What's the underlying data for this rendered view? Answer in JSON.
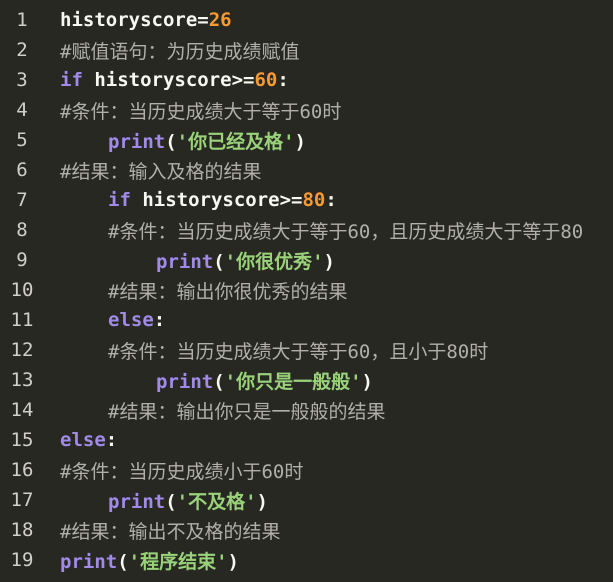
{
  "editor": {
    "lines": [
      {
        "num": "1",
        "parts": {
          "a": "historyscore=",
          "b": "26"
        }
      },
      {
        "num": "2",
        "comment": "#赋值语句：为历史成绩赋值"
      },
      {
        "num": "3",
        "parts": {
          "kw": "if",
          "a": " historyscore>=",
          "b": "60",
          "c": ":"
        }
      },
      {
        "num": "4",
        "comment": "#条件：当历史成绩大于等于60时"
      },
      {
        "num": "5",
        "parts": {
          "kw": "print",
          "a": "(",
          "s": "'你已经及格'",
          "c": ")"
        }
      },
      {
        "num": "6",
        "comment": "#结果：输入及格的结果"
      },
      {
        "num": "7",
        "parts": {
          "kw": "if",
          "a": " historyscore>=",
          "b": "80",
          "c": ":"
        }
      },
      {
        "num": "8",
        "comment": "#条件：当历史成绩大于等于60，且历史成绩大于等于80"
      },
      {
        "num": "9",
        "parts": {
          "kw": "print",
          "a": "(",
          "s": "'你很优秀'",
          "c": ")"
        }
      },
      {
        "num": "10",
        "comment": "#结果：输出你很优秀的结果"
      },
      {
        "num": "11",
        "parts": {
          "kw": "else",
          "c": ":"
        }
      },
      {
        "num": "12",
        "comment": "#条件：当历史成绩大于等于60，且小于80时"
      },
      {
        "num": "13",
        "parts": {
          "kw": "print",
          "a": "(",
          "s": "'你只是一般般'",
          "c": ")"
        }
      },
      {
        "num": "14",
        "comment": "#结果：输出你只是一般般的结果"
      },
      {
        "num": "15",
        "parts": {
          "kw": "else",
          "c": ":"
        }
      },
      {
        "num": "16",
        "comment": "#条件：当历史成绩小于60时"
      },
      {
        "num": "17",
        "parts": {
          "kw": "print",
          "a": "(",
          "s": "'不及格'",
          "c": ")"
        }
      },
      {
        "num": "18",
        "comment": "#结果：输出不及格的结果"
      },
      {
        "num": "19",
        "parts": {
          "kw": "print",
          "a": "(",
          "s": "'程序结束'",
          "c": ")"
        }
      }
    ]
  },
  "colors": {
    "background": "#272822",
    "keyword": "#a28ae8",
    "number": "#f79a32",
    "string": "#9ad27a",
    "comment": "#b0b0a8",
    "text": "#f8f8f2"
  }
}
